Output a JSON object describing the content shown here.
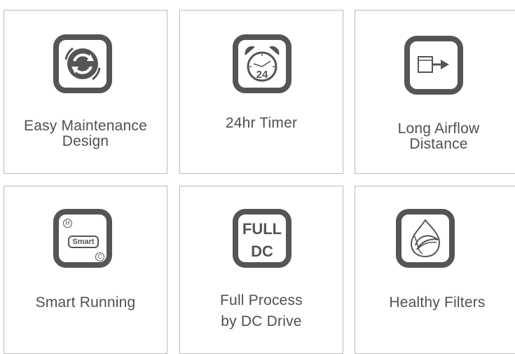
{
  "features": [
    {
      "label_lines": [
        "Easy Maintenance",
        "Design"
      ],
      "icon": "refresh-arrows-icon"
    },
    {
      "label_lines": [
        "24hr Timer"
      ],
      "icon": "alarm-clock-icon",
      "clock_text": "24"
    },
    {
      "label_lines": [
        "Long Airflow",
        "Distance"
      ],
      "icon": "airflow-arrow-icon"
    },
    {
      "label_lines": [
        "Smart Running"
      ],
      "icon": "smart-mode-icon",
      "smart_text": "Smart",
      "top_letter": "H",
      "bottom_letter": "C"
    },
    {
      "label_lines": [
        "Full Process",
        "by DC Drive"
      ],
      "icon": "full-dc-icon",
      "dc_line1": "FULL",
      "dc_line2": "DC"
    },
    {
      "label_lines": [
        "Healthy Filters"
      ],
      "icon": "leaf-drop-icon"
    }
  ],
  "colors": {
    "icon_stroke": "#555555",
    "border": "#bdbdbd",
    "text": "#505050"
  }
}
